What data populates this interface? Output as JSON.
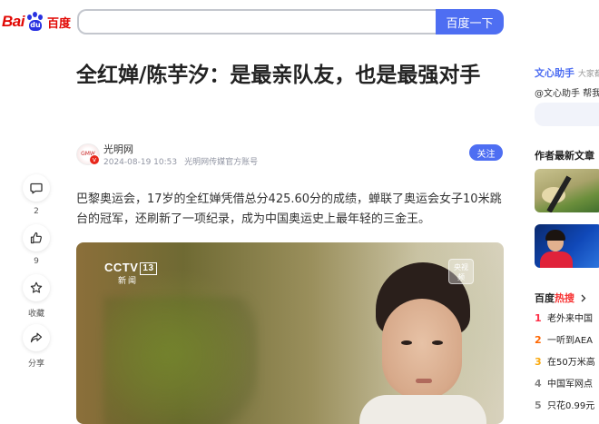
{
  "header": {
    "logo_bai": "Bai",
    "logo_du": "du",
    "logo_cn": "百度",
    "search_value": "",
    "search_button": "百度一下"
  },
  "article": {
    "title": "全红婵/陈芋汐：是最亲队友，也是最强对手",
    "author": {
      "name": "光明网",
      "avatar_text": "GMW",
      "date": "2024-08-19 10:53",
      "source_note": "光明网传媒官方账号"
    },
    "follow_label": "关注",
    "paragraph": "巴黎奥运会，17岁的全红婵凭借总分425.60分的成绩，蝉联了奥运会女子10米跳台的冠军，还刷新了一项纪录，成为中国奥运史上最年轻的三金王。",
    "video": {
      "channel_logo": "CCTV",
      "channel_number": "13",
      "channel_sub": "新闻",
      "corner_logo_top": "央视",
      "corner_logo_bottom": "频"
    }
  },
  "actions": [
    {
      "icon": "comment-icon",
      "label": "2"
    },
    {
      "icon": "thumbs-up-icon",
      "label": "9"
    },
    {
      "icon": "star-icon",
      "label": "收藏"
    },
    {
      "icon": "share-icon",
      "label": "分享"
    }
  ],
  "sidebar": {
    "assistant_title": "文心助手",
    "assistant_tag": "大家都",
    "assistant_desc": "@文心助手 帮我",
    "author_recent_title": "作者最新文章",
    "hot_title_part1": "百度",
    "hot_title_part2": "热搜",
    "hot_list": [
      {
        "rank": "1",
        "text": "老外来中国"
      },
      {
        "rank": "2",
        "text": "一听到AEA"
      },
      {
        "rank": "3",
        "text": "在50万米高"
      },
      {
        "rank": "4",
        "text": "中国军网点"
      },
      {
        "rank": "5",
        "text": "只花0.99元"
      }
    ]
  },
  "colors": {
    "brand_blue": "#4e6ef2",
    "brand_red": "#e10602",
    "hot_red": "#f73131"
  }
}
